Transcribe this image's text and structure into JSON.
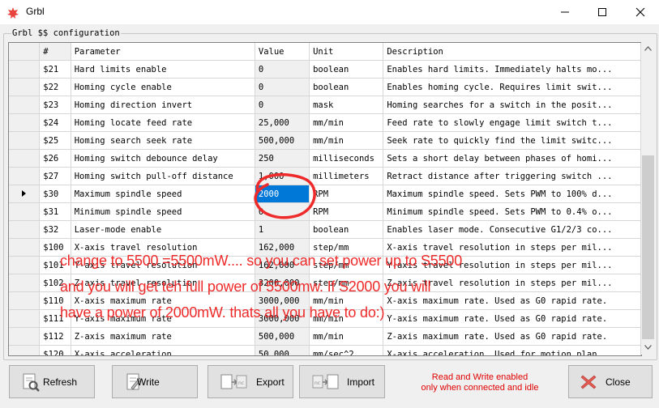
{
  "window": {
    "title": "Grbl"
  },
  "group": {
    "label": "Grbl $$ configuration"
  },
  "grid": {
    "columns": [
      "#",
      "Parameter",
      "Value",
      "Unit",
      "Description"
    ],
    "rows": [
      [
        "$21",
        "Hard limits enable",
        "0",
        "boolean",
        "Enables hard limits. Immediately halts mo..."
      ],
      [
        "$22",
        "Homing cycle enable",
        "0",
        "boolean",
        "Enables homing cycle. Requires limit swit..."
      ],
      [
        "$23",
        "Homing direction invert",
        "0",
        "mask",
        "Homing searches for a switch in the posit..."
      ],
      [
        "$24",
        "Homing locate feed rate",
        "25,000",
        "mm/min",
        "Feed rate to slowly engage limit switch t..."
      ],
      [
        "$25",
        "Homing search seek rate",
        "500,000",
        "mm/min",
        "Seek rate to quickly find the limit switc..."
      ],
      [
        "$26",
        "Homing switch debounce delay",
        "250",
        "milliseconds",
        "Sets a short delay between phases of homi..."
      ],
      [
        "$27",
        "Homing switch pull-off distance",
        "1,000",
        "millimeters",
        "Retract distance after triggering switch ..."
      ],
      [
        "$30",
        "Maximum spindle speed",
        "2000",
        "RPM",
        "Maximum spindle speed. Sets PWM to 100% d..."
      ],
      [
        "$31",
        "Minimum spindle speed",
        "0",
        "RPM",
        "Minimum spindle speed. Sets PWM to 0.4% o..."
      ],
      [
        "$32",
        "Laser-mode enable",
        "1",
        "boolean",
        "Enables laser mode. Consecutive G1/2/3 co..."
      ],
      [
        "$100",
        "X-axis travel resolution",
        "162,000",
        "step/mm",
        "X-axis travel resolution in steps per mil..."
      ],
      [
        "$101",
        "Y-axis travel resolution",
        "162,000",
        "step/mm",
        "Y-axis travel resolution in steps per mil..."
      ],
      [
        "$102",
        "Z-axis travel resolution",
        "3200,000",
        "step/mm",
        "Z-axis travel resolution in steps per mil..."
      ],
      [
        "$110",
        "X-axis maximum rate",
        "3000,000",
        "mm/min",
        "X-axis maximum rate. Used as G0 rapid rate."
      ],
      [
        "$111",
        "Y-axis maximum rate",
        "3000,000",
        "mm/min",
        "Y-axis maximum rate. Used as G0 rapid rate."
      ],
      [
        "$112",
        "Z-axis maximum rate",
        "500,000",
        "mm/min",
        "Z-axis maximum rate. Used as G0 rapid rate."
      ],
      [
        "$120",
        "X-axis acceleration",
        "50,000",
        "mm/sec^2",
        "X-axis acceleration. Used for motion plan..."
      ]
    ]
  },
  "buttons": {
    "refresh": "Refresh",
    "write": "Write",
    "export": "Export",
    "import": "Import",
    "close": "Close"
  },
  "notice": {
    "line1": "Read and Write enabled",
    "line2": "only when connected and idle"
  },
  "annotation": {
    "line1": "change to 5500 =5500mW.... so you can set power up to S5500",
    "line2": "and you will get teh full power of 5500mw. If S2000 you will",
    "line3": "have a power of 2000mW. thats all you have to do:)",
    "color": "#ee2a2a"
  },
  "colors": {
    "selection": "#0078d7",
    "close_icon": "#e35a52"
  }
}
